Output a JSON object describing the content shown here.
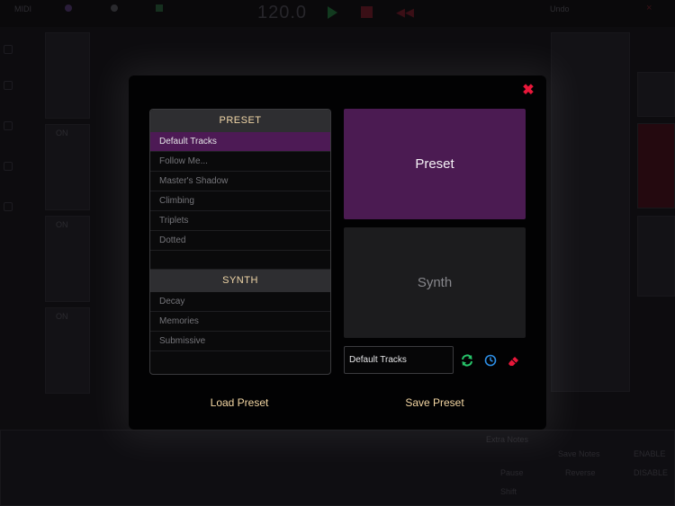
{
  "topbar": {
    "midi_label": "MIDI",
    "tempo": "120.0",
    "undo_label": "Undo",
    "close_glyph": "×",
    "rewind_glyph": "◀◀"
  },
  "background": {
    "track_on_labels": [
      "ON",
      "ON",
      "ON"
    ],
    "right_labels": [
      "Extra Notes",
      "Save Notes",
      "ENABLE",
      "Reverse",
      "DISABLE",
      "Pause",
      "Shift"
    ]
  },
  "modal": {
    "close_glyph": "✖",
    "preset_section": {
      "header": "PRESET",
      "items": [
        "Default Tracks",
        "Follow Me...",
        "Master's Shadow",
        "Climbing",
        "Triplets",
        "Dotted"
      ],
      "selected_index": 0
    },
    "synth_section": {
      "header": "SYNTH",
      "items": [
        "Decay",
        "Memories",
        "Submissive"
      ]
    },
    "tiles": {
      "preset_label": "Preset",
      "synth_label": "Synth"
    },
    "name_input": {
      "value": "Default Tracks"
    },
    "icons": {
      "refresh": "refresh-icon",
      "clock": "clock-icon",
      "eraser": "eraser-icon"
    },
    "load_label": "Load Preset",
    "save_label": "Save Preset"
  },
  "colors": {
    "accent_purple": "#4b1b52",
    "header_text": "#f1d7a8",
    "close_red": "#e8173a",
    "refresh_green": "#27c46a",
    "clock_blue": "#2d8ee6",
    "eraser_red": "#e8173a"
  }
}
